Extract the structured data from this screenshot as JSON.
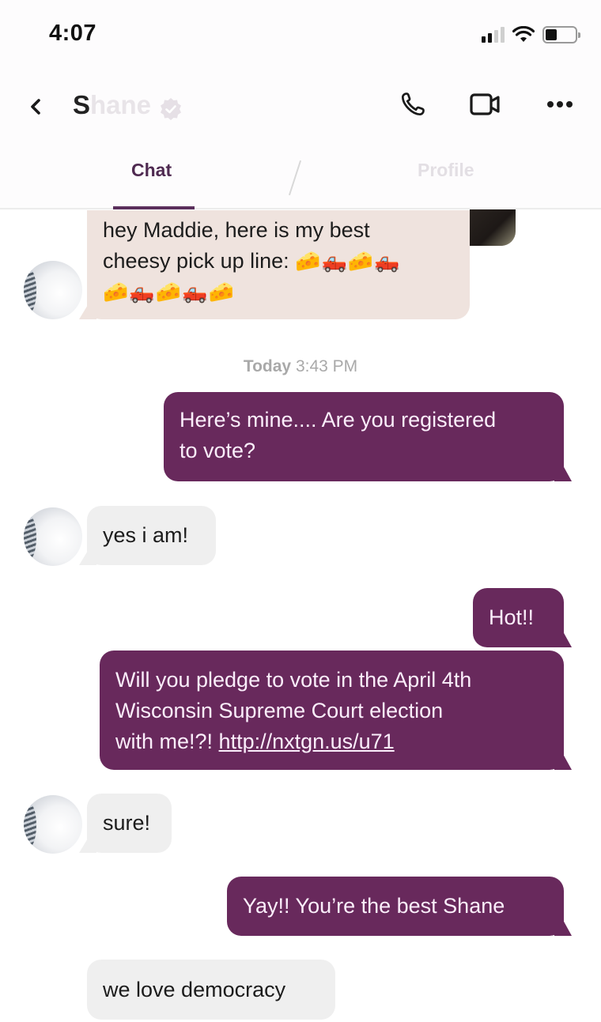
{
  "status_bar": {
    "time": "4:07",
    "icons": [
      "cellular-signal-icon",
      "wifi-icon",
      "battery-icon"
    ],
    "signal_bars_active": 2,
    "signal_bars_total": 4,
    "battery_level": 0.3
  },
  "header": {
    "contact_name_first": "S",
    "contact_name_rest": "hane",
    "verified": true,
    "back_icon": "chevron-left-icon",
    "actions": [
      {
        "name": "voice-call-button",
        "icon": "phone-icon"
      },
      {
        "name": "video-call-button",
        "icon": "video-camera-icon"
      },
      {
        "name": "more-options-button",
        "icon": "ellipsis-icon"
      }
    ]
  },
  "tabs": {
    "items": [
      {
        "label": "Chat",
        "active": true
      },
      {
        "label": "Profile",
        "active": false
      }
    ]
  },
  "colors": {
    "accent": "#68295c",
    "tab_active": "#4f2a51",
    "incoming_bubble": "#efefef",
    "incoming_bubble_beige": "#efe3de",
    "outgoing_text": "#fbeefb"
  },
  "messages": [
    {
      "direction": "incoming",
      "lines": [
        "hey Maddie, here is my best",
        "cheesy pick up line: "
      ],
      "emoji_line1": "🧀🛻🧀🛻",
      "emoji_line2": "🧀🛻🧀🛻🧀",
      "avatar": true
    },
    {
      "type": "timestamp",
      "day": "Today",
      "time": "3:43 PM"
    },
    {
      "direction": "outgoing",
      "lines": [
        "Here’s mine.... Are you registered",
        "to vote?"
      ]
    },
    {
      "direction": "incoming",
      "text": "yes i am!",
      "avatar": true
    },
    {
      "direction": "outgoing",
      "text": "Hot!!"
    },
    {
      "direction": "outgoing",
      "lines": [
        "Will you pledge to vote in the April 4th",
        "Wisconsin Supreme Court election",
        "with me!?! "
      ],
      "link": "http://nxtgn.us/u71"
    },
    {
      "direction": "incoming",
      "text": "sure!",
      "avatar": true
    },
    {
      "direction": "outgoing",
      "text": "Yay!! You’re the best Shane"
    },
    {
      "direction": "incoming",
      "text": "we love democracy",
      "avatar": false
    }
  ]
}
